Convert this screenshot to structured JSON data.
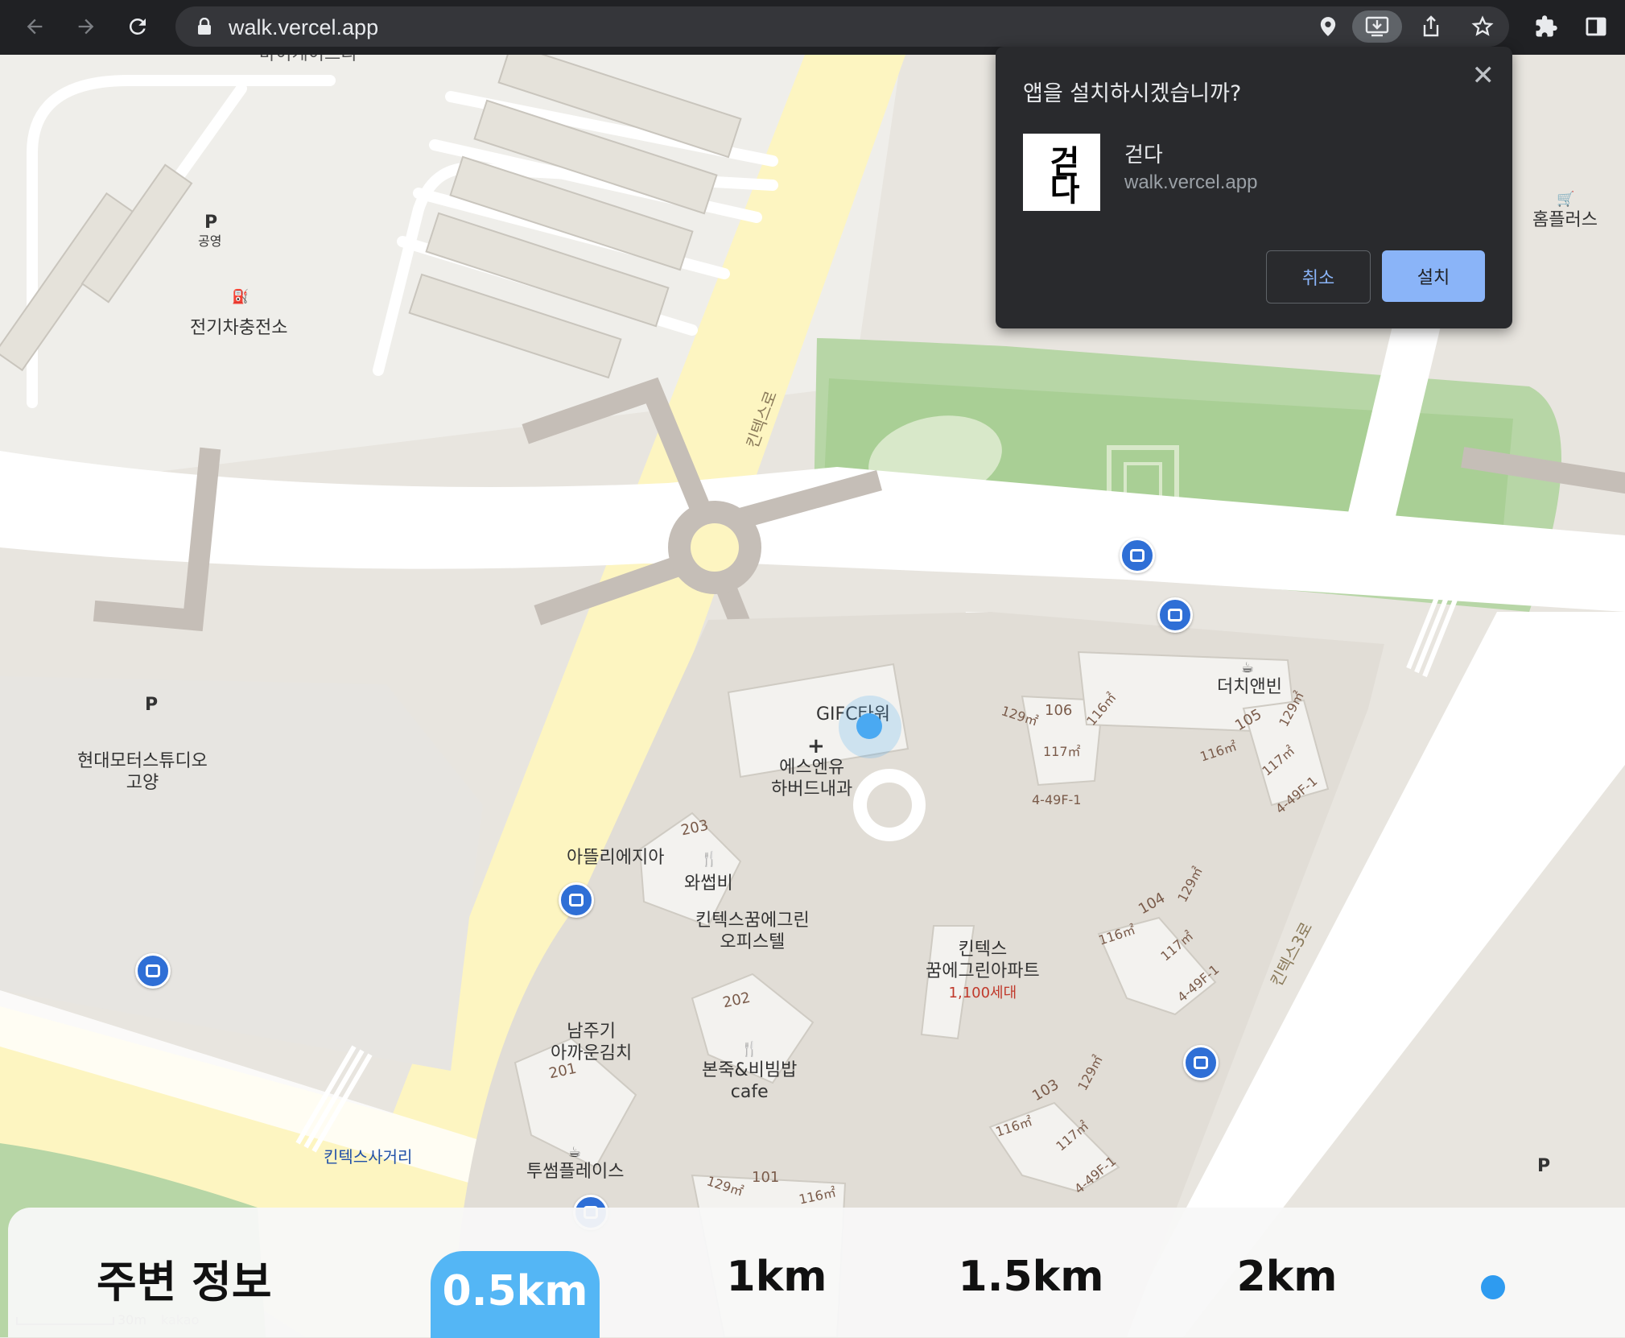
{
  "browser": {
    "url": "walk.vercel.app"
  },
  "install_dialog": {
    "title": "앱을 설치하시겠습니까?",
    "app_name": "걷다",
    "app_icon_text": "걷다",
    "app_url": "walk.vercel.app",
    "cancel_label": "취소",
    "install_label": "설치",
    "close_label": "✕"
  },
  "map": {
    "places": {
      "top_cut": "바이케이트리",
      "ev_charge": "전기차충전소",
      "public_parking": "공영",
      "hyundai_1": "현대모터스튜디오",
      "hyundai_2": "고양",
      "gifc": "GIFC타워",
      "clinic_1": "에스엔유",
      "clinic_2": "하버드내과",
      "atteuri": "아뜰리에지아",
      "wasabi": "와썹비",
      "officetel_1": "킨텍스꿈에그린",
      "officetel_2": "오피스텔",
      "apt_1": "킨텍스",
      "apt_2": "꿈에그린아파트",
      "apt_3": "1,100세대",
      "namjugi_1": "남주기",
      "namjugi_2": "아까운김치",
      "bonjuk_1": "본죽&비빔밥",
      "bonjuk_2": "cafe",
      "twosome": "투썸플레이스",
      "dutch": "더치앤빈",
      "homeplus": "홈플러스",
      "kintex_crossroad": "킨텍스사거리",
      "parking_label": "P"
    },
    "roads": {
      "kintex_ro": "킨텍스로",
      "kintex_3_ro": "킨텍스3로"
    },
    "buildings": [
      "203",
      "202",
      "201",
      "101",
      "103",
      "104",
      "105",
      "106"
    ],
    "unit_labels": {
      "u129": "129㎡",
      "u116": "116㎡",
      "u117": "117㎡",
      "floors": "4-49F-1"
    },
    "scale": "30m",
    "attribution": "kakao",
    "current_location_color": "#4aa9f2"
  },
  "panel": {
    "title": "주변 정보",
    "distances": [
      "0.5km",
      "1km",
      "1.5km",
      "2km"
    ],
    "selected_index": 0,
    "accent": "#54b6f5"
  }
}
